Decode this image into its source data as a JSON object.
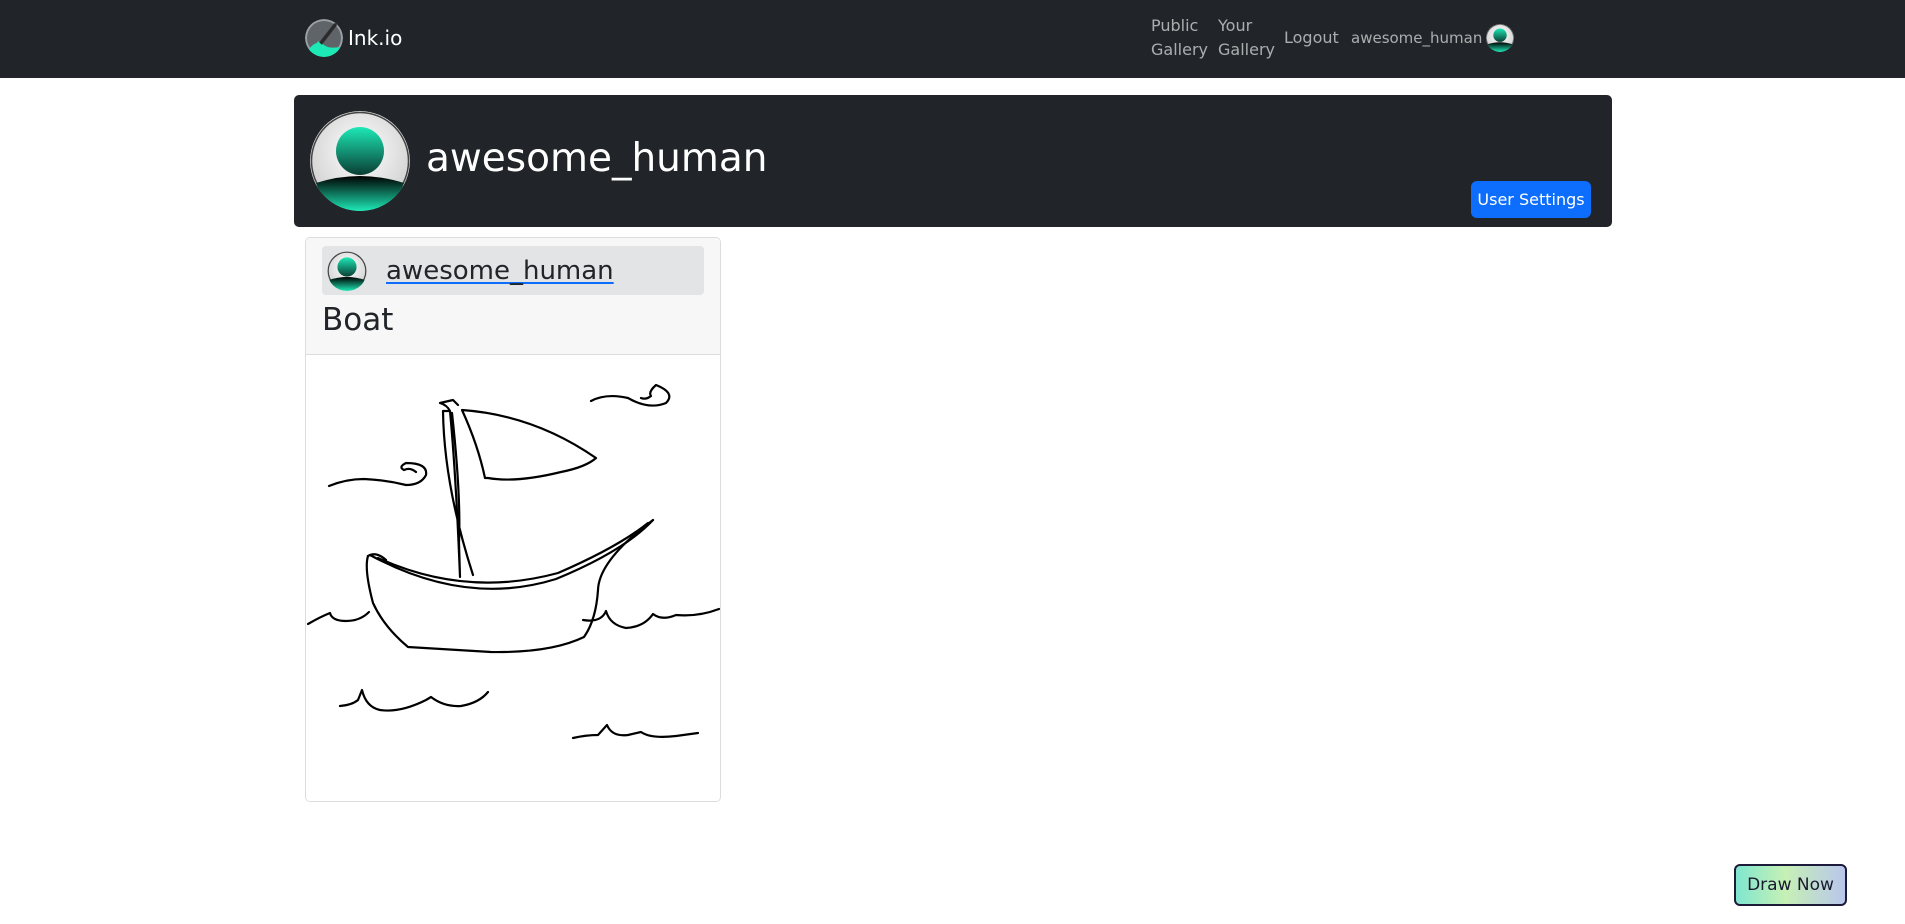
{
  "navbar": {
    "brand": "Ink.io",
    "links": {
      "public_gallery": [
        "Public",
        "Gallery"
      ],
      "your_gallery": [
        "Your",
        "Gallery"
      ],
      "logout": "Logout"
    },
    "username": "awesome_human",
    "brand_icon": "paintbrush-logo-icon",
    "avatar_icon": "user-avatar-icon"
  },
  "profile": {
    "username": "awesome_human",
    "settings_button": "User Settings"
  },
  "drawings": [
    {
      "author": "awesome_human",
      "title": "Boat",
      "image_icon": "sailboat-sketch"
    }
  ],
  "draw_now_button": "Draw Now",
  "colors": {
    "navbar_bg": "#212529",
    "primary": "#0d6efd",
    "avatar_teal": "#1de9b6",
    "card_header_bg": "#f7f7f7"
  }
}
